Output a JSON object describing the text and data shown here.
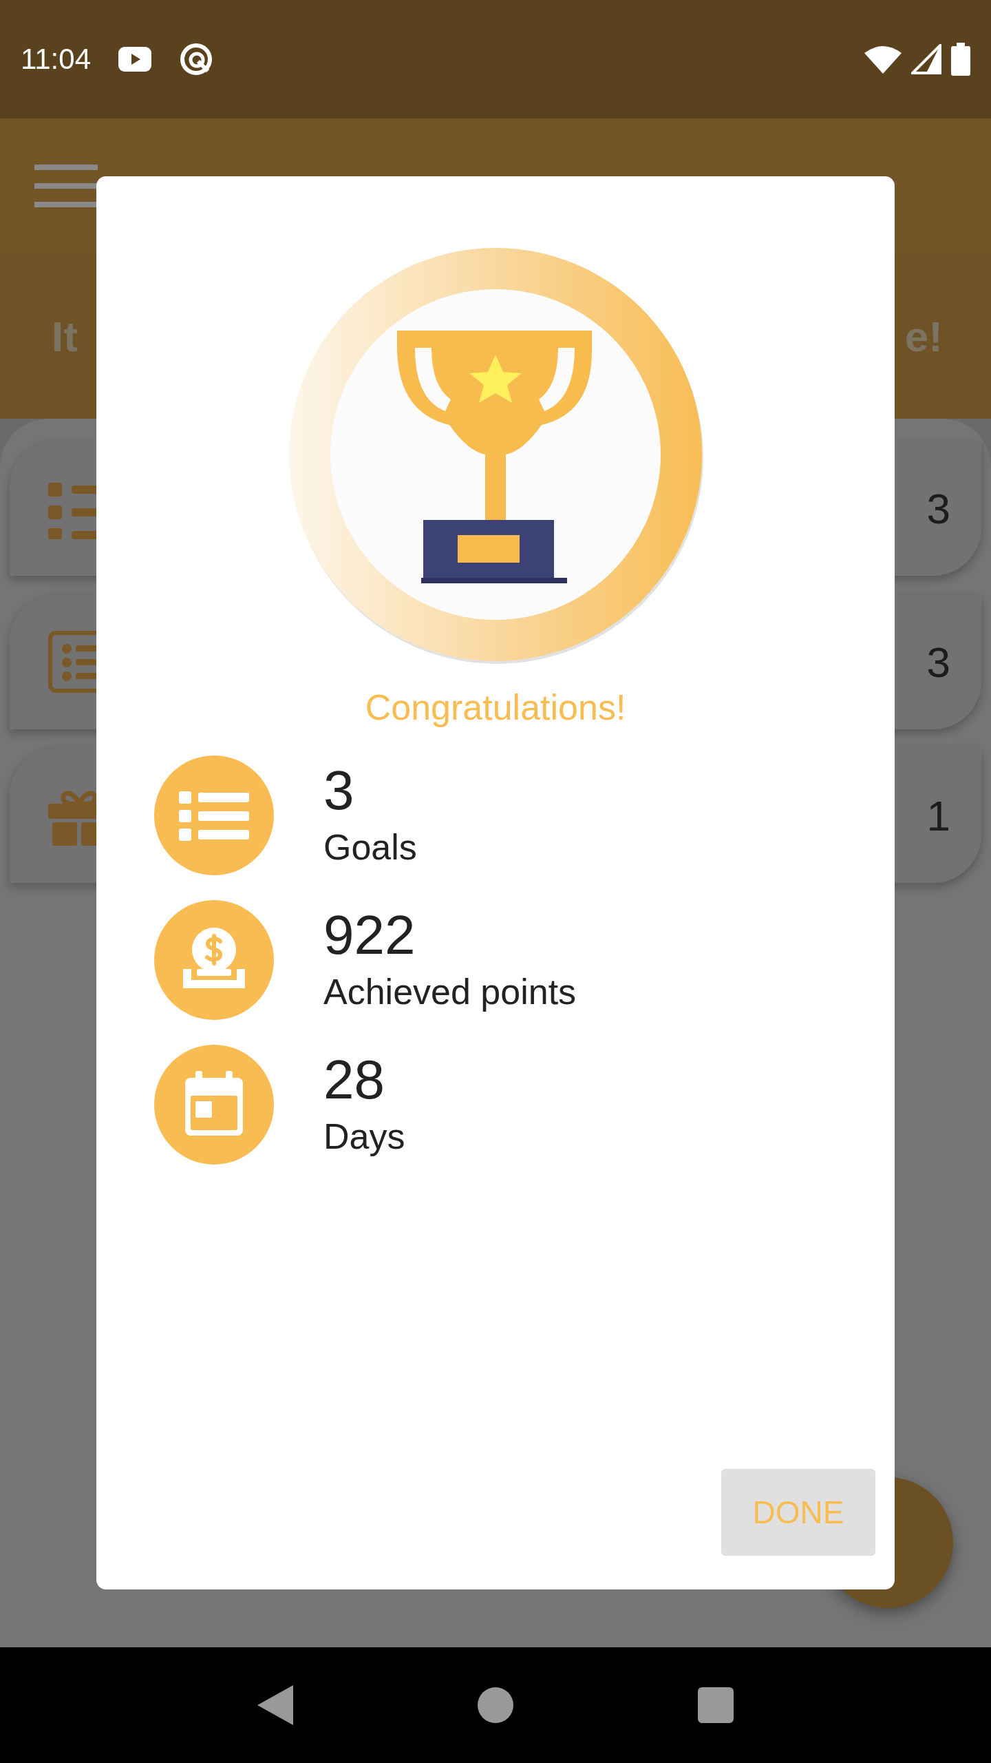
{
  "status_bar": {
    "time": "11:04"
  },
  "banner": {
    "text_left": "It",
    "text_right": "e!"
  },
  "cards": [
    {
      "kind": "goals",
      "count": "3"
    },
    {
      "kind": "list",
      "count": "3"
    },
    {
      "kind": "gift",
      "count": "1"
    }
  ],
  "dialog": {
    "title": "Congratulations!",
    "stats": [
      {
        "kind": "goals",
        "value": "3",
        "label": "Goals"
      },
      {
        "kind": "points",
        "value": "922",
        "label": "Achieved points"
      },
      {
        "kind": "days",
        "value": "28",
        "label": "Days"
      }
    ],
    "button": "DONE"
  }
}
